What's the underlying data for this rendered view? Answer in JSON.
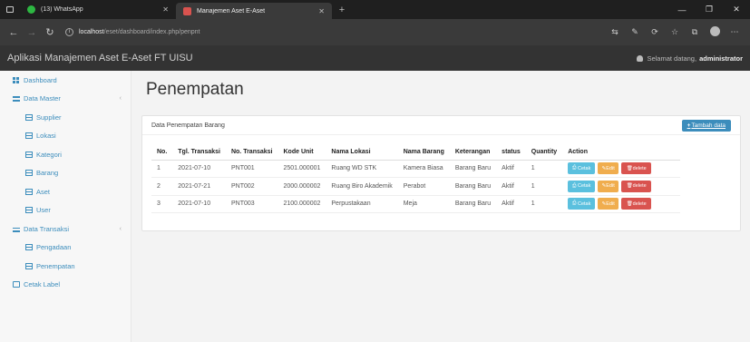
{
  "browser": {
    "tabs": [
      {
        "title": "(13) WhatsApp",
        "active": false
      },
      {
        "title": "Manajemen Aset E-Aset",
        "active": true
      }
    ],
    "url_host": "localhost",
    "url_path": "/eset/dashboard/index.php/penpnt"
  },
  "app": {
    "title": "Aplikasi Manajemen Aset E-Aset FT UISU",
    "greeting": "Selamat datang,",
    "username": "administrator"
  },
  "sidebar": {
    "items": [
      {
        "label": "Dashboard",
        "icon": "dashboard-icon",
        "level": "top"
      },
      {
        "label": "Data Master",
        "icon": "list-icon",
        "level": "top",
        "chevron": "‹"
      },
      {
        "label": "Supplier",
        "icon": "table-icon",
        "level": "sub"
      },
      {
        "label": "Lokasi",
        "icon": "table-icon",
        "level": "sub"
      },
      {
        "label": "Kategori",
        "icon": "table-icon",
        "level": "sub"
      },
      {
        "label": "Barang",
        "icon": "table-icon",
        "level": "sub"
      },
      {
        "label": "Aset",
        "icon": "table-icon",
        "level": "sub"
      },
      {
        "label": "User",
        "icon": "table-icon",
        "level": "sub"
      },
      {
        "label": "Data Transaksi",
        "icon": "bank-icon",
        "level": "top",
        "chevron": "‹"
      },
      {
        "label": "Pengadaan",
        "icon": "table-icon",
        "level": "sub"
      },
      {
        "label": "Penempatan",
        "icon": "table-icon",
        "level": "sub"
      },
      {
        "label": "Cetak Label",
        "icon": "printer-icon",
        "level": "top"
      }
    ]
  },
  "main": {
    "page_title": "Penempatan",
    "panel_title": "Data Penempatan Barang",
    "add_button": "Tambah data",
    "table": {
      "headers": [
        "No.",
        "Tgl. Transaksi",
        "No. Transaksi",
        "Kode Unit",
        "Nama Lokasi",
        "Nama Barang",
        "Keterangan",
        "status",
        "Quantity",
        "Action"
      ],
      "rows": [
        [
          "1",
          "2021-07-10",
          "PNT001",
          "2501.000001",
          "Ruang WD STK",
          "Kamera Biasa",
          "Barang Baru",
          "Aktif",
          "1"
        ],
        [
          "2",
          "2021-07-21",
          "PNT002",
          "2000.000002",
          "Ruang Biro Akademik",
          "Perabot",
          "Barang Baru",
          "Aktif",
          "1"
        ],
        [
          "3",
          "2021-07-10",
          "PNT003",
          "2100.000002",
          "Perpustakaan",
          "Meja",
          "Barang Baru",
          "Aktif",
          "1"
        ]
      ],
      "actions": [
        "Cetak",
        "Edit",
        "delete"
      ]
    }
  },
  "colors": {
    "accent": "#3c8dbc",
    "cetak": "#5bc0de",
    "edit": "#f0ad4e",
    "delete": "#d9534f"
  }
}
